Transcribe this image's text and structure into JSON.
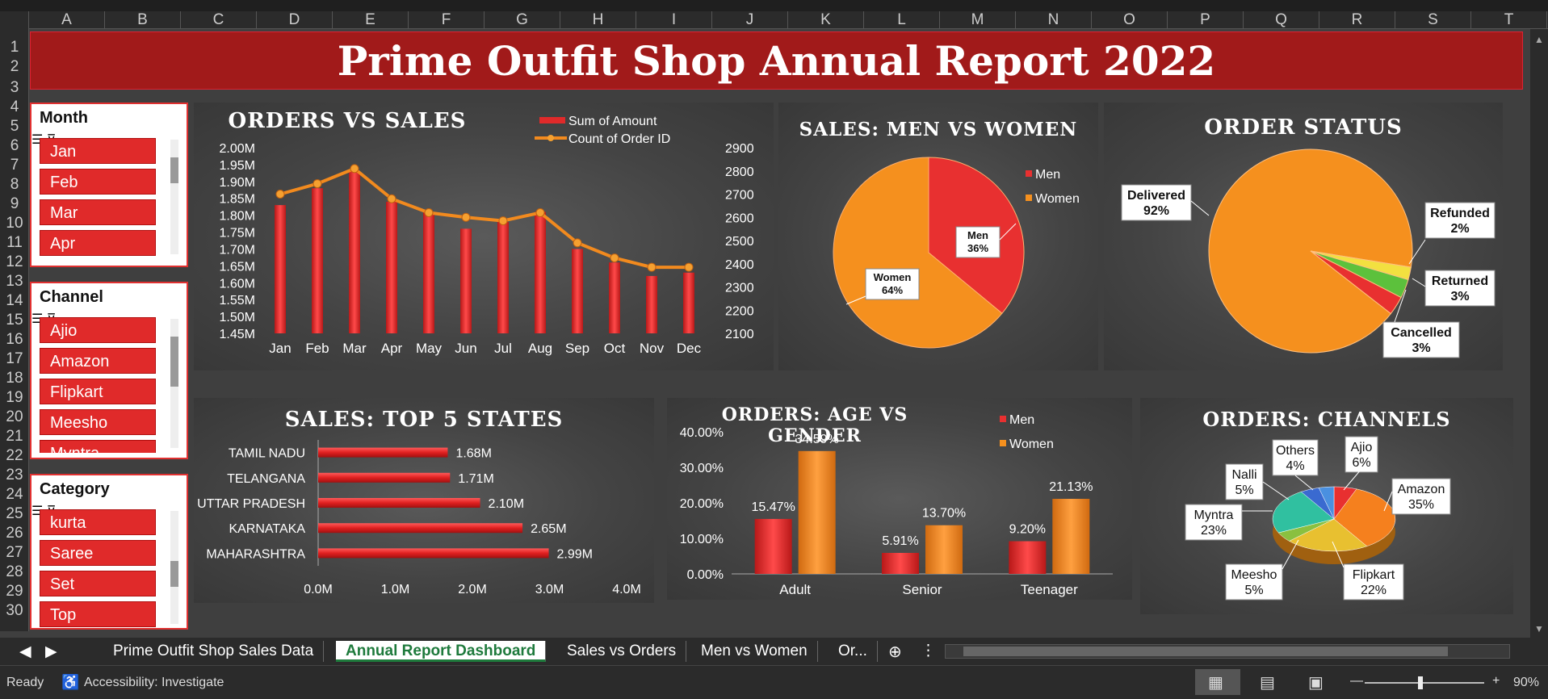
{
  "columns": [
    "A",
    "B",
    "C",
    "D",
    "E",
    "F",
    "G",
    "H",
    "I",
    "J",
    "K",
    "L",
    "M",
    "N",
    "O",
    "P",
    "Q",
    "R",
    "S",
    "T"
  ],
  "rows": [
    "1",
    "2",
    "3",
    "4",
    "5",
    "6",
    "7",
    "8",
    "9",
    "10",
    "11",
    "12",
    "13",
    "14",
    "15",
    "16",
    "17",
    "18",
    "19",
    "20",
    "21",
    "22",
    "23",
    "24",
    "25",
    "26",
    "27",
    "28",
    "29",
    "30"
  ],
  "title": "Prime Outfit Shop Annual Report 2022",
  "slicers": [
    {
      "label": "Month",
      "items": [
        "Jan",
        "Feb",
        "Mar",
        "Apr"
      ]
    },
    {
      "label": "Channel",
      "items": [
        "Ajio",
        "Amazon",
        "Flipkart",
        "Meesho",
        "Myntra"
      ]
    },
    {
      "label": "Category",
      "items": [
        "kurta",
        "Saree",
        "Set",
        "Top"
      ]
    }
  ],
  "colors": {
    "accent": "#e02a2a",
    "orange": "#f28a1e",
    "title_bg": "#a11a1a"
  },
  "chart_data": [
    {
      "type": "bar",
      "title": "ORDERS VS SALES",
      "categories": [
        "Jan",
        "Feb",
        "Mar",
        "Apr",
        "May",
        "Jun",
        "Jul",
        "Aug",
        "Sep",
        "Oct",
        "Nov",
        "Dec"
      ],
      "series": [
        {
          "name": "Sum of Amount",
          "type": "bar",
          "values": [
            1.83,
            1.88,
            1.93,
            1.84,
            1.81,
            1.76,
            1.78,
            1.81,
            1.7,
            1.66,
            1.62,
            1.63
          ]
        },
        {
          "name": "Count of Order ID",
          "type": "line",
          "values": [
            2700,
            2745,
            2810,
            2680,
            2620,
            2600,
            2585,
            2620,
            2490,
            2425,
            2385,
            2385
          ]
        }
      ],
      "y_ticks": [
        "2.00M",
        "1.95M",
        "1.90M",
        "1.85M",
        "1.80M",
        "1.75M",
        "1.70M",
        "1.65M",
        "1.60M",
        "1.55M",
        "1.50M",
        "1.45M"
      ],
      "y2_ticks": [
        "2900",
        "2800",
        "2700",
        "2600",
        "2500",
        "2400",
        "2300",
        "2200",
        "2100"
      ],
      "ylim": [
        1.45,
        2.0
      ],
      "y2lim": [
        2100,
        2900
      ]
    },
    {
      "type": "pie",
      "title": "SALES: MEN VS WOMEN",
      "categories": [
        "Men",
        "Women"
      ],
      "values": [
        36,
        64
      ],
      "labels": [
        "Men\n36%",
        "Women\n64%"
      ]
    },
    {
      "type": "pie",
      "title": "ORDER STATUS",
      "categories": [
        "Delivered",
        "Refunded",
        "Returned",
        "Cancelled"
      ],
      "values": [
        92,
        2,
        3,
        3
      ],
      "labels": [
        "Delivered\n92%",
        "Refunded\n2%",
        "Returned\n3%",
        "Cancelled\n3%"
      ]
    },
    {
      "type": "bar",
      "title": "SALES: TOP 5 STATES",
      "categories": [
        "TAMIL NADU",
        "TELANGANA",
        "UTTAR PRADESH",
        "KARNATAKA",
        "MAHARASHTRA"
      ],
      "values": [
        1.68,
        1.71,
        2.1,
        2.65,
        2.99
      ],
      "value_labels": [
        "1.68M",
        "1.71M",
        "2.10M",
        "2.65M",
        "2.99M"
      ],
      "x_ticks": [
        "0.0M",
        "1.0M",
        "2.0M",
        "3.0M",
        "4.0M"
      ],
      "xlim": [
        0,
        4.0
      ]
    },
    {
      "type": "bar",
      "title": "ORDERS: AGE VS GENDER",
      "categories": [
        "Adult",
        "Senior",
        "Teenager"
      ],
      "series": [
        {
          "name": "Men",
          "values": [
            15.47,
            5.91,
            9.2
          ],
          "labels": [
            "15.47%",
            "5.91%",
            "9.20%"
          ]
        },
        {
          "name": "Women",
          "values": [
            34.59,
            13.7,
            21.13
          ],
          "labels": [
            "34.59%",
            "13.70%",
            "21.13%"
          ]
        }
      ],
      "y_ticks": [
        "40.00%",
        "30.00%",
        "20.00%",
        "10.00%",
        "0.00%"
      ],
      "ylim": [
        0,
        40
      ]
    },
    {
      "type": "pie",
      "title": "ORDERS: CHANNELS",
      "categories": [
        "Ajio",
        "Amazon",
        "Flipkart",
        "Meesho",
        "Myntra",
        "Nalli",
        "Others"
      ],
      "values": [
        6,
        35,
        22,
        5,
        23,
        5,
        4
      ],
      "labels": [
        "Ajio\n6%",
        "Amazon\n35%",
        "Flipkart\n22%",
        "Meesho\n5%",
        "Myntra\n23%",
        "Nalli\n5%",
        "Others\n4%"
      ]
    }
  ],
  "tabs": [
    "Prime Outfit Shop Sales Data",
    "Annual Report Dashboard",
    "Sales vs Orders",
    "Men vs Women",
    "Or..."
  ],
  "active_tab": 1,
  "status": {
    "ready": "Ready",
    "accessibility": "Accessibility: Investigate",
    "zoom": "90%"
  }
}
